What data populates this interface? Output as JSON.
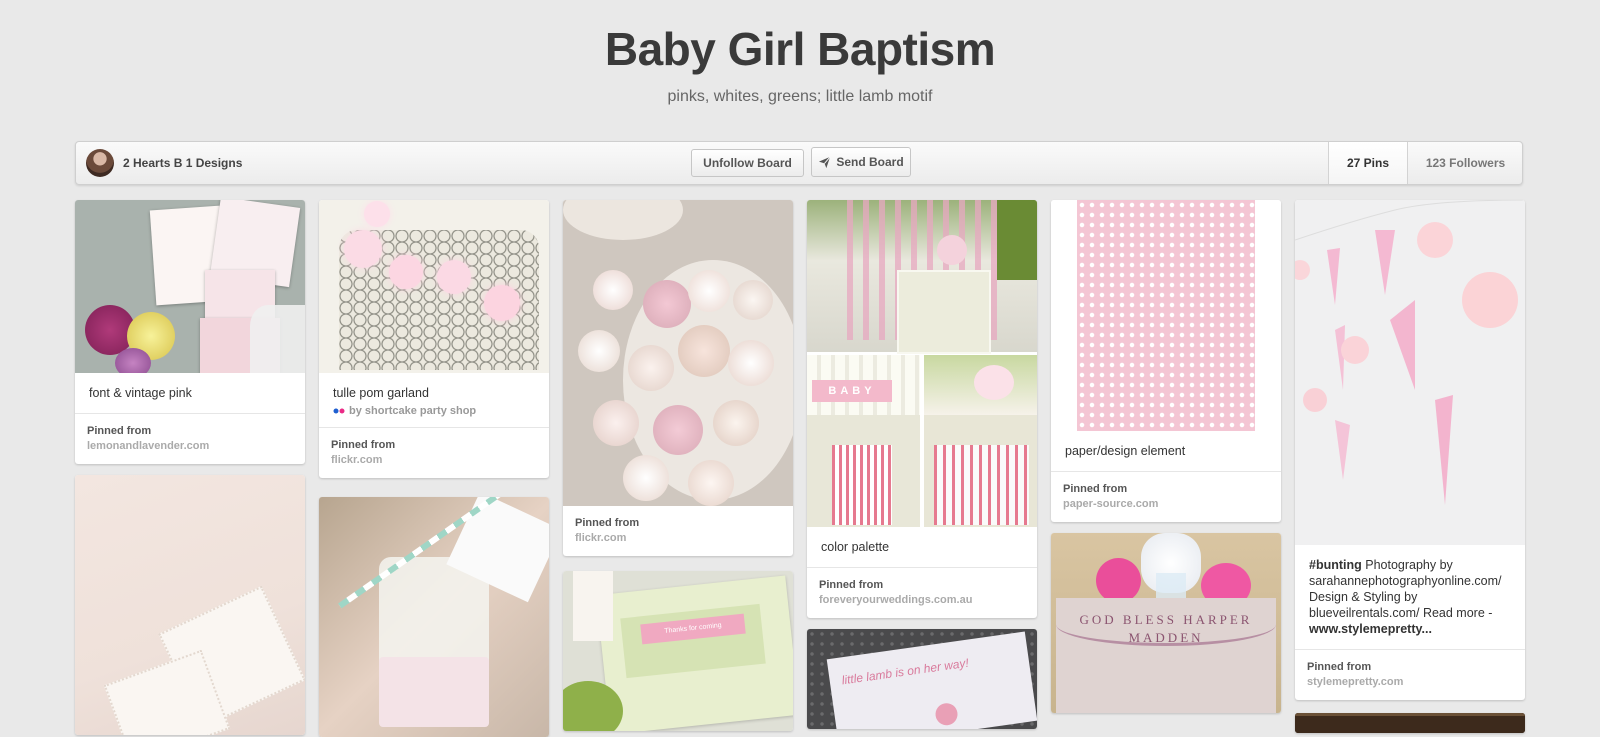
{
  "board": {
    "title": "Baby Girl Baptism",
    "description": "pinks, whites, greens; little lamb motif"
  },
  "toolbar": {
    "owner_name": "2 Hearts B 1 Designs",
    "unfollow_label": "Unfollow Board",
    "send_label": "Send Board",
    "pins_count": "27 Pins",
    "followers_count": "123 Followers"
  },
  "colors": {
    "background": "#e9e9e9",
    "card": "#ffffff",
    "accent_pink": "#f4c6d4",
    "title": "#3a3a3a"
  },
  "pins": [
    {
      "description": "font & vintage pink",
      "pinned_from": "Pinned from",
      "source": "lemonandlavender.com"
    },
    {
      "description": "tulle pom garland",
      "attribution": "by shortcake party shop",
      "pinned_from": "Pinned from",
      "source": "flickr.com"
    },
    {
      "pinned_from": "Pinned from",
      "source": "flickr.com"
    },
    {
      "description": "color palette",
      "pinned_from": "Pinned from",
      "source": "foreveryourweddings.com.au"
    },
    {
      "description": "paper/design element",
      "pinned_from": "Pinned from",
      "source": "paper-source.com"
    },
    {
      "description_tag": "#bunting",
      "description_text": " Photography by sarahannephotographyonline.com/ Design & Styling by blueveilrentals.com/ Read more - ",
      "description_link": "www.stylemepretty...",
      "pinned_from": "Pinned from",
      "source": "stylemepretty.com"
    }
  ],
  "image_texts": {
    "banner_text": "GOD BLESS HARPER MADDEN",
    "card_text": "little lamb is on her way!",
    "baby_block": "BABY",
    "shower_label": "Thanks for coming"
  }
}
